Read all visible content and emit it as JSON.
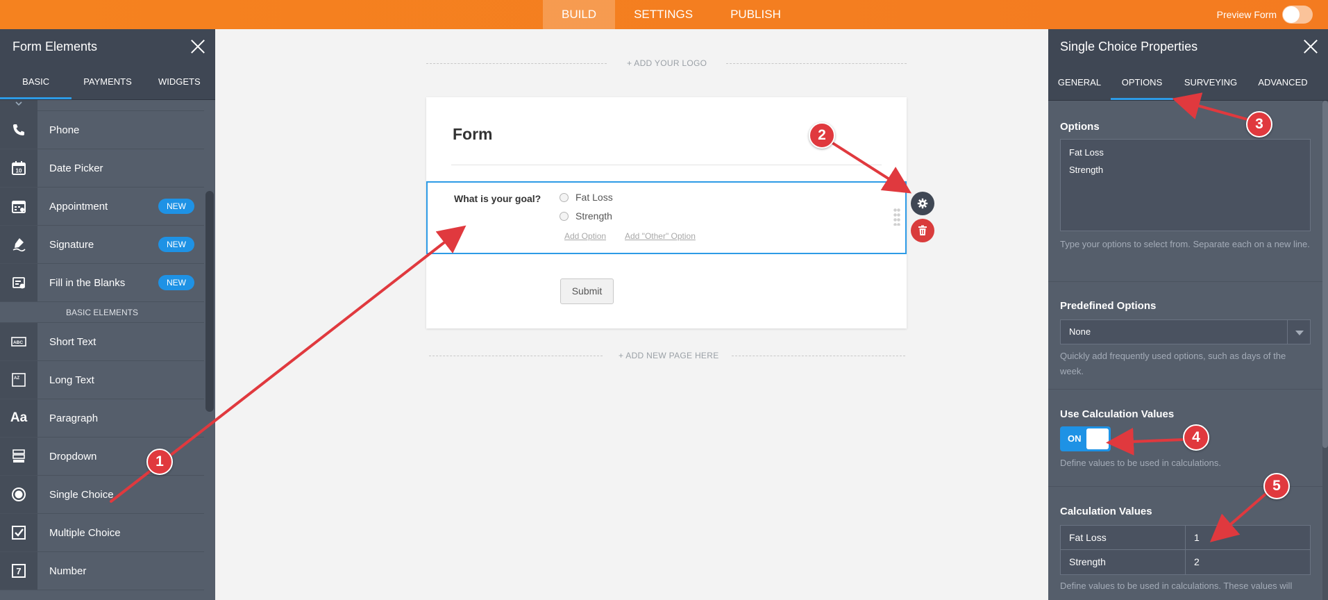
{
  "topbar": {
    "tabs": [
      {
        "label": "BUILD"
      },
      {
        "label": "SETTINGS"
      },
      {
        "label": "PUBLISH"
      }
    ],
    "active_tab": "BUILD",
    "preview_label": "Preview Form",
    "preview_on": false
  },
  "left_panel": {
    "title": "Form Elements",
    "tabs": [
      {
        "label": "BASIC"
      },
      {
        "label": "PAYMENTS"
      },
      {
        "label": "WIDGETS"
      }
    ],
    "active_tab": "BASIC",
    "items": [
      {
        "label": "Phone",
        "icon": "phone-icon"
      },
      {
        "label": "Date Picker",
        "icon": "calendar-icon",
        "icon_text": "10"
      },
      {
        "label": "Appointment",
        "icon": "appointment-icon",
        "badge": "NEW"
      },
      {
        "label": "Signature",
        "icon": "signature-pen-icon",
        "badge": "NEW"
      },
      {
        "label": "Fill in the Blanks",
        "icon": "fill-blanks-icon",
        "badge": "NEW"
      }
    ],
    "section_label": "BASIC ELEMENTS",
    "basic_items": [
      {
        "label": "Short Text",
        "icon": "short-text-icon",
        "icon_text": "ABC"
      },
      {
        "label": "Long Text",
        "icon": "long-text-icon",
        "icon_text": "AZ"
      },
      {
        "label": "Paragraph",
        "icon": "paragraph-icon",
        "icon_text": "Aa"
      },
      {
        "label": "Dropdown",
        "icon": "dropdown-icon"
      },
      {
        "label": "Single Choice",
        "icon": "radio-icon"
      },
      {
        "label": "Multiple Choice",
        "icon": "checkbox-icon"
      },
      {
        "label": "Number",
        "icon": "number-icon",
        "icon_text": "7"
      }
    ]
  },
  "canvas": {
    "add_logo": "+ ADD YOUR LOGO",
    "form_title": "Form",
    "question": {
      "label": "What is your goal?",
      "options": [
        "Fat Loss",
        "Strength"
      ],
      "add_option": "Add Option",
      "add_other_option": "Add \"Other\" Option"
    },
    "submit_label": "Submit",
    "add_page": "+ ADD NEW PAGE HERE"
  },
  "right_panel": {
    "title": "Single Choice Properties",
    "tabs": [
      {
        "label": "GENERAL"
      },
      {
        "label": "OPTIONS"
      },
      {
        "label": "SURVEYING"
      },
      {
        "label": "ADVANCED"
      }
    ],
    "active_tab": "OPTIONS",
    "options_section": {
      "label": "Options",
      "values": [
        "Fat Loss",
        "Strength"
      ],
      "help": "Type your options to select from. Separate each on a new line."
    },
    "predefined": {
      "label": "Predefined Options",
      "value": "None",
      "help": "Quickly add frequently used options, such as days of the week."
    },
    "use_calc": {
      "label": "Use Calculation Values",
      "toggle_label": "ON",
      "on": true,
      "help": "Define values to be used in calculations."
    },
    "calc_values": {
      "label": "Calculation Values",
      "rows": [
        {
          "option": "Fat Loss",
          "value": "1"
        },
        {
          "option": "Strength",
          "value": "2"
        }
      ],
      "help": "Define values to be used in calculations. These values will"
    }
  },
  "annotations": [
    "1",
    "2",
    "3",
    "4",
    "5"
  ],
  "colors": {
    "accent": "#f5821f",
    "panel": "#555e6b",
    "blue": "#1e92e5",
    "arrow": "#e0393e"
  }
}
